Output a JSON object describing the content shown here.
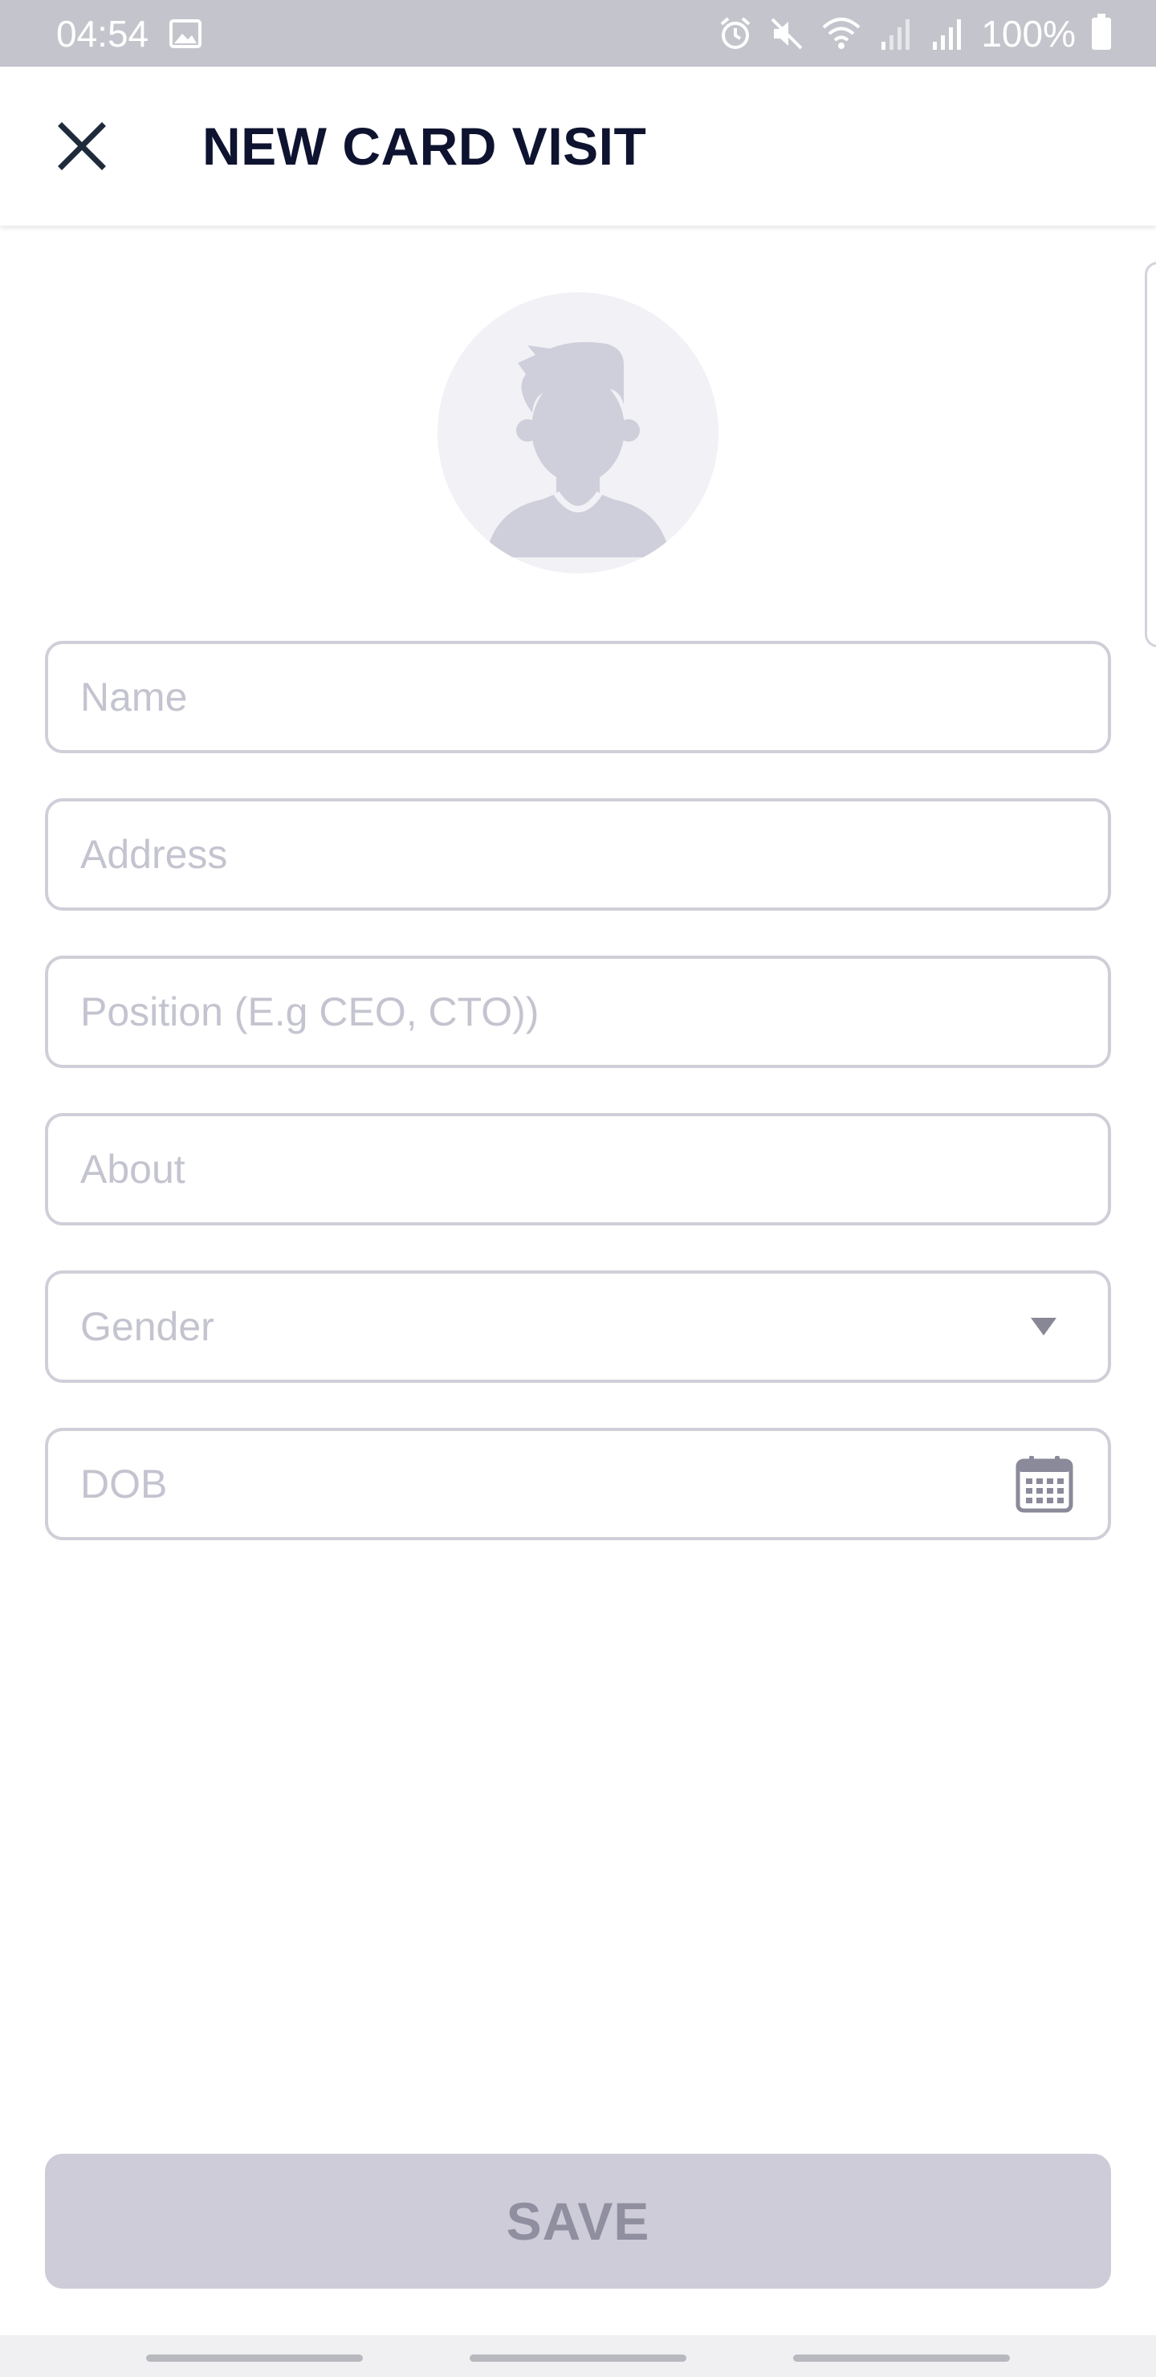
{
  "status_bar": {
    "time": "04:54",
    "battery": "100%",
    "icons": [
      "image-icon",
      "alarm-icon",
      "mute-icon",
      "wifi-icon",
      "signal-icon",
      "signal-icon-2",
      "battery-icon"
    ]
  },
  "app_bar": {
    "title": "NEW CARD VISIT",
    "close_icon": "close-icon"
  },
  "form": {
    "name_placeholder": "Name",
    "address_placeholder": "Address",
    "position_placeholder": "Position (E.g CEO, CTO))",
    "about_placeholder": "About",
    "gender_placeholder": "Gender",
    "dob_placeholder": "DOB"
  },
  "save_label": "SAVE",
  "colors": {
    "title": "#0e1330",
    "field_border": "#cfcfd9",
    "placeholder": "#c4c4d0",
    "save_bg": "#cdccd8",
    "save_text": "#8f8fa0",
    "status_bar": "#c4c4cc"
  }
}
